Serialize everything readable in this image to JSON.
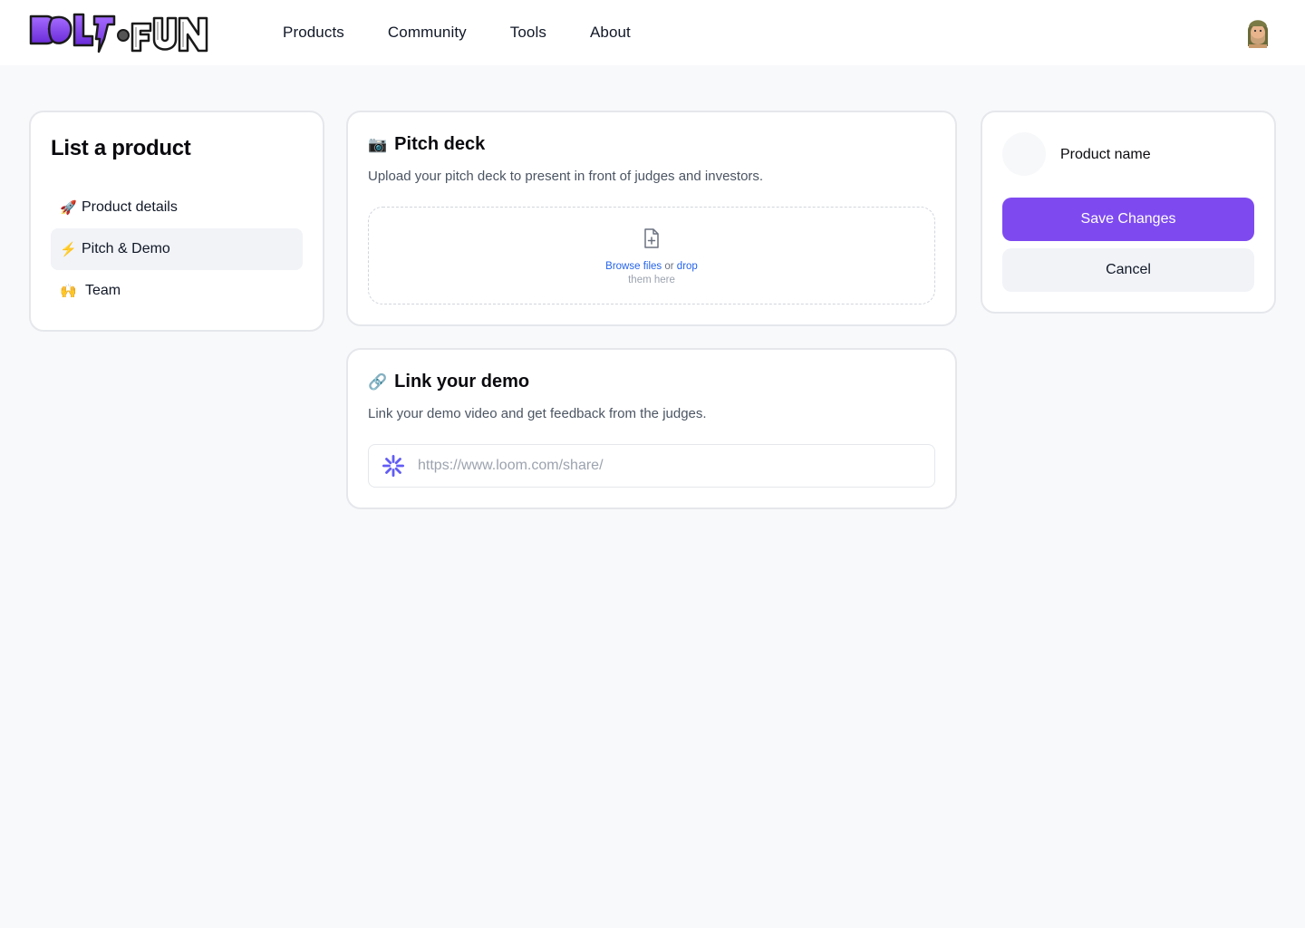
{
  "header": {
    "logo_alt": "BOLT.FUN",
    "nav": [
      {
        "label": "Products"
      },
      {
        "label": "Community"
      },
      {
        "label": "Tools"
      },
      {
        "label": "About"
      }
    ]
  },
  "sidebar": {
    "title": "List a product",
    "items": [
      {
        "emoji": "🚀",
        "label": "Product details",
        "active": false
      },
      {
        "emoji": "⚡",
        "label": "Pitch & Demo",
        "active": true
      },
      {
        "emoji": "🙌",
        "label": "Team",
        "active": false
      }
    ]
  },
  "pitch_deck": {
    "emoji": "📷",
    "title": "Pitch deck",
    "description": "Upload your pitch deck to present in front of judges and investors.",
    "browse_label": "Browse files",
    "or_label": "or",
    "drop_label": "drop",
    "drop_suffix": "them here"
  },
  "demo": {
    "emoji": "🔗",
    "title": "Link your demo",
    "description": "Link your demo video and get feedback from the judges.",
    "input_placeholder": "https://www.loom.com/share/",
    "input_value": ""
  },
  "actions": {
    "product_name": "Product name",
    "save_label": "Save Changes",
    "cancel_label": "Cancel"
  },
  "colors": {
    "accent": "#7e4af0",
    "link": "#2563eb",
    "loom": "#625df5"
  }
}
